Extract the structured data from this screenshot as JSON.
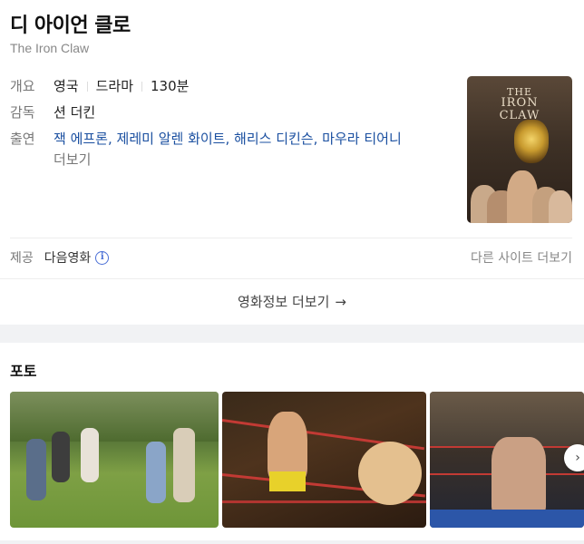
{
  "movie": {
    "title": "디 아이언 클로",
    "original_title": "The Iron Claw"
  },
  "overview": {
    "label": "개요",
    "country": "영국",
    "genre": "드라마",
    "runtime": "130분"
  },
  "director": {
    "label": "감독",
    "name": "션 더킨"
  },
  "cast": {
    "label": "출연",
    "members": [
      "잭 에프론",
      "제레미 알렌 화이트",
      "해리스 디킨슨",
      "마우라 티어니"
    ],
    "separator": ",",
    "more_label": "더보기"
  },
  "poster": {
    "title_lines": [
      "THE",
      "IRON",
      "CLAW"
    ]
  },
  "provider": {
    "label": "제공",
    "name": "다음영화",
    "info_icon": "i",
    "other_sites_label": "다른 사이트 더보기"
  },
  "more_movie_info": {
    "label": "영화정보 더보기",
    "arrow": "→"
  },
  "photos": {
    "section_title": "포토",
    "next_icon": "›",
    "items": [
      {
        "name": "photo-field"
      },
      {
        "name": "photo-wrestling-ring"
      },
      {
        "name": "photo-celebration"
      }
    ]
  },
  "colors": {
    "link": "#1a4fa0",
    "label": "#777777",
    "info_icon": "#4a6fd6"
  }
}
